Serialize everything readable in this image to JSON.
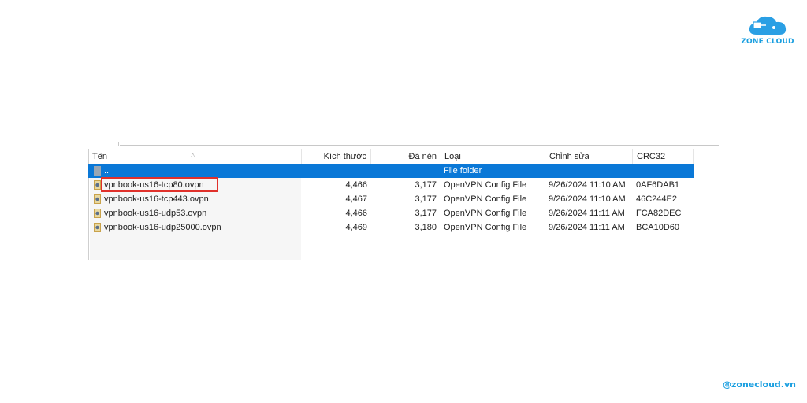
{
  "brand": {
    "logo_text": "ZONE CLOUD",
    "handle": "@zonecloud.vn",
    "accent_color": "#1a9fe0"
  },
  "columns": [
    {
      "key": "name",
      "label": "Tên"
    },
    {
      "key": "size",
      "label": "Kích thước"
    },
    {
      "key": "packed",
      "label": "Đã nén"
    },
    {
      "key": "type",
      "label": "Loại"
    },
    {
      "key": "modified",
      "label": "Chỉnh sửa"
    },
    {
      "key": "crc",
      "label": "CRC32"
    }
  ],
  "sort": {
    "column": "name",
    "direction": "ascending"
  },
  "rows": [
    {
      "name": "..",
      "size": "",
      "packed": "",
      "type": "File folder",
      "modified": "",
      "crc": "",
      "selected": true,
      "icon": "folder-up-icon"
    },
    {
      "name": "vpnbook-us16-tcp80.ovpn",
      "size": "4,466",
      "packed": "3,177",
      "type": "OpenVPN Config File",
      "modified": "9/26/2024 11:10 AM",
      "crc": "0AF6DAB1",
      "selected": false,
      "highlighted": true,
      "icon": "ovpn-file-icon"
    },
    {
      "name": "vpnbook-us16-tcp443.ovpn",
      "size": "4,467",
      "packed": "3,177",
      "type": "OpenVPN Config File",
      "modified": "9/26/2024 11:10 AM",
      "crc": "46C244E2",
      "selected": false,
      "icon": "ovpn-file-icon"
    },
    {
      "name": "vpnbook-us16-udp53.ovpn",
      "size": "4,466",
      "packed": "3,177",
      "type": "OpenVPN Config File",
      "modified": "9/26/2024 11:11 AM",
      "crc": "FCA82DEC",
      "selected": false,
      "icon": "ovpn-file-icon"
    },
    {
      "name": "vpnbook-us16-udp25000.ovpn",
      "size": "4,469",
      "packed": "3,180",
      "type": "OpenVPN Config File",
      "modified": "9/26/2024 11:11 AM",
      "crc": "BCA10D60",
      "selected": false,
      "icon": "ovpn-file-icon"
    }
  ],
  "colors": {
    "selection": "#0a78d7",
    "highlight_box": "#e0312b"
  }
}
